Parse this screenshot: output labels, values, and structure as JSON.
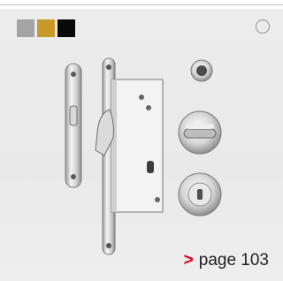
{
  "colors": {
    "swatches": [
      "#a4a4a4",
      "#c79a2a",
      "#0a0a0a"
    ],
    "card_background": "#ececec",
    "accent": "#e3001b"
  },
  "swatches": [
    {
      "name": "grey-finish-swatch",
      "color": "#a4a4a4"
    },
    {
      "name": "gold-finish-swatch",
      "color": "#c79a2a"
    },
    {
      "name": "black-finish-swatch",
      "color": "#0a0a0a"
    }
  ],
  "product_image": {
    "icon": "pocket-door-lock-set-icon"
  },
  "page_reference": {
    "arrow": ">",
    "label": "page 103"
  }
}
